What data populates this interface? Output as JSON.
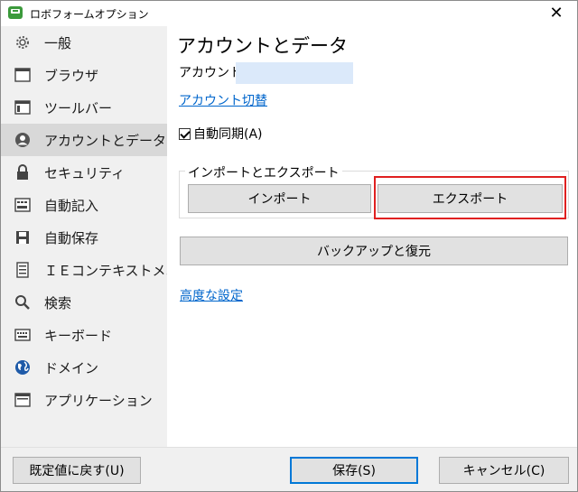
{
  "window": {
    "title": "ロボフォームオプション",
    "close_glyph": "✕"
  },
  "sidebar": {
    "items": [
      {
        "label": "一般",
        "icon": "gear-icon"
      },
      {
        "label": "ブラウザ",
        "icon": "browser-window-icon"
      },
      {
        "label": "ツールバー",
        "icon": "toolbar-icon"
      },
      {
        "label": "アカウントとデータ",
        "icon": "user-icon",
        "active": true
      },
      {
        "label": "セキュリティ",
        "icon": "lock-icon"
      },
      {
        "label": "自動記入",
        "icon": "form-fill-icon"
      },
      {
        "label": "自動保存",
        "icon": "save-disk-icon"
      },
      {
        "label": "ＩＥコンテキストメニ",
        "icon": "context-menu-icon"
      },
      {
        "label": "検索",
        "icon": "search-icon"
      },
      {
        "label": "キーボード",
        "icon": "keyboard-icon"
      },
      {
        "label": "ドメイン",
        "icon": "globe-icon"
      },
      {
        "label": "アプリケーション",
        "icon": "application-window-icon"
      }
    ]
  },
  "main": {
    "title": "アカウントとデータ",
    "account_label": "アカウント:",
    "switch_account_link": "アカウント切替",
    "auto_sync_label": "自動同期(A)",
    "auto_sync_checked": true,
    "import_export_group": "インポートとエクスポート",
    "import_button": "インポート",
    "export_button": "エクスポート",
    "backup_restore_button": "バックアップと復元",
    "advanced_settings_link": "高度な設定"
  },
  "footer": {
    "reset_button": "既定値に戻す(U)",
    "save_button": "保存(S)",
    "cancel_button": "キャンセル(C)"
  },
  "colors": {
    "accent_link": "#0066cc",
    "highlight_box": "#e02020",
    "sidebar_bg": "#f0f0f0",
    "sidebar_active": "#d8d8d8",
    "default_button_border": "#0078d7"
  }
}
